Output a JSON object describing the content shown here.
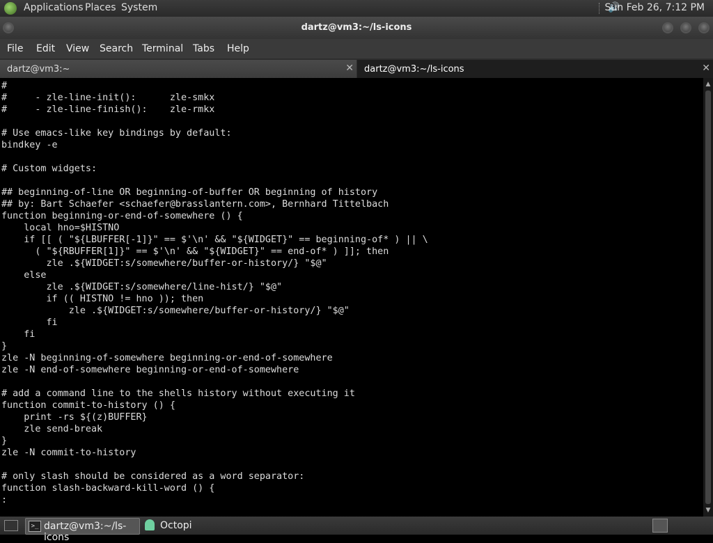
{
  "top_panel": {
    "menus": [
      "Applications",
      "Places",
      "System"
    ],
    "datetime": "Sun Feb 26,  7:12 PM"
  },
  "window": {
    "title": "dartz@vm3:~/ls-icons"
  },
  "menubar": {
    "items": [
      "File",
      "Edit",
      "View",
      "Search",
      "Terminal",
      "Tabs",
      "Help"
    ]
  },
  "tabs": [
    {
      "label": "dartz@vm3:~",
      "active": false
    },
    {
      "label": "dartz@vm3:~/ls-icons",
      "active": true
    }
  ],
  "terminal": {
    "lines": [
      "#",
      "#     - zle-line-init():      zle-smkx",
      "#     - zle-line-finish():    zle-rmkx",
      "",
      "# Use emacs-like key bindings by default:",
      "bindkey -e",
      "",
      "# Custom widgets:",
      "",
      "## beginning-of-line OR beginning-of-buffer OR beginning of history",
      "## by: Bart Schaefer <schaefer@brasslantern.com>, Bernhard Tittelbach",
      "function beginning-or-end-of-somewhere () {",
      "    local hno=$HISTNO",
      "    if [[ ( \"${LBUFFER[-1]}\" == $'\\n' && \"${WIDGET}\" == beginning-of* ) || \\",
      "      ( \"${RBUFFER[1]}\" == $'\\n' && \"${WIDGET}\" == end-of* ) ]]; then",
      "        zle .${WIDGET:s/somewhere/buffer-or-history/} \"$@\"",
      "    else",
      "        zle .${WIDGET:s/somewhere/line-hist/} \"$@\"",
      "        if (( HISTNO != hno )); then",
      "            zle .${WIDGET:s/somewhere/buffer-or-history/} \"$@\"",
      "        fi",
      "    fi",
      "}",
      "zle -N beginning-of-somewhere beginning-or-end-of-somewhere",
      "zle -N end-of-somewhere beginning-or-end-of-somewhere",
      "",
      "# add a command line to the shells history without executing it",
      "function commit-to-history () {",
      "    print -rs ${(z)BUFFER}",
      "    zle send-break",
      "}",
      "zle -N commit-to-history",
      "",
      "# only slash should be considered as a word separator:",
      "function slash-backward-kill-word () {",
      ":"
    ]
  },
  "taskbar": {
    "items": [
      {
        "label": "dartz@vm3:~/ls-icons",
        "icon": "terminal-icon",
        "active": true
      },
      {
        "label": "Octopi",
        "icon": "ghost-icon",
        "active": false
      }
    ]
  },
  "colors": {
    "panel": "#2f2f2f",
    "terminal_bg": "#000000",
    "terminal_fg": "#dddddd"
  }
}
